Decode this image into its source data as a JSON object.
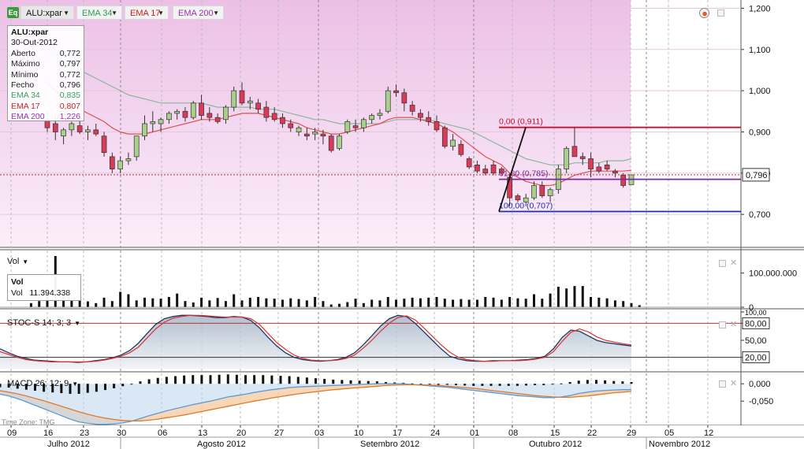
{
  "toolbar": {
    "logo_text": "Eq",
    "symbol_chip": "ALU:xpar",
    "ema34_chip": "EMA 34",
    "ema17_chip": "EMA 17",
    "ema200_chip": "EMA 200"
  },
  "info_box": {
    "title": "ALU:xpar",
    "date": "30-Out-2012",
    "rows": [
      {
        "label": "Aberto",
        "value": "0,772",
        "color": "#222222"
      },
      {
        "label": "Máximo",
        "value": "0,797",
        "color": "#222222"
      },
      {
        "label": "Mínimo",
        "value": "0,772",
        "color": "#222222"
      },
      {
        "label": "Fecho",
        "value": "0,796",
        "color": "#222222"
      },
      {
        "label": "EMA 34",
        "value": "0,835",
        "color": "#3aa05a"
      },
      {
        "label": "EMA 17",
        "value": "0,807",
        "color": "#cc2020"
      },
      {
        "label": "EMA 200",
        "value": "1,226",
        "color": "#a030b0"
      }
    ]
  },
  "vol_box": {
    "title": "Vol",
    "label": "Vol",
    "value": "11.394.338"
  },
  "panels": {
    "vol_label": "Vol",
    "stoch_label": "STOC-S 14; 3; 3",
    "macd_label": "MACD 26; 12; 9",
    "timezone": "Time Zone: TMG"
  },
  "chart_data": [
    {
      "type": "candlestick",
      "title": "ALU:xpar",
      "overlays": [
        "EMA 34",
        "EMA 17",
        "EMA 200"
      ],
      "ylim": [
        0.62,
        1.22
      ],
      "y_ticks": [
        "1,200",
        "1,100",
        "1,000",
        "0,900",
        "0,800",
        "0,700"
      ],
      "last_price_label": "0,796",
      "x_day_ticks": [
        "09",
        "16",
        "23",
        "30",
        "06",
        "13",
        "20",
        "27",
        "03",
        "10",
        "17",
        "24",
        "01",
        "08",
        "15",
        "22",
        "29",
        "05",
        "12"
      ],
      "x_month_labels": [
        "Julho 2012",
        "Agosto 2012",
        "Setembro 2012",
        "Outubro 2012",
        "Novembro 2012"
      ],
      "candles": [
        {
          "o": 0.93,
          "h": 0.95,
          "l": 0.9,
          "c": 0.91
        },
        {
          "o": 0.92,
          "h": 0.94,
          "l": 0.88,
          "c": 0.9
        },
        {
          "o": 0.89,
          "h": 0.91,
          "l": 0.87,
          "c": 0.905
        },
        {
          "o": 0.905,
          "h": 0.925,
          "l": 0.89,
          "c": 0.92
        },
        {
          "o": 0.915,
          "h": 0.93,
          "l": 0.895,
          "c": 0.9
        },
        {
          "o": 0.9,
          "h": 0.915,
          "l": 0.88,
          "c": 0.905
        },
        {
          "o": 0.905,
          "h": 0.92,
          "l": 0.89,
          "c": 0.895
        },
        {
          "o": 0.89,
          "h": 0.9,
          "l": 0.84,
          "c": 0.85
        },
        {
          "o": 0.84,
          "h": 0.85,
          "l": 0.8,
          "c": 0.81
        },
        {
          "o": 0.81,
          "h": 0.84,
          "l": 0.8,
          "c": 0.83
        },
        {
          "o": 0.83,
          "h": 0.85,
          "l": 0.82,
          "c": 0.835
        },
        {
          "o": 0.84,
          "h": 0.89,
          "l": 0.83,
          "c": 0.89
        },
        {
          "o": 0.89,
          "h": 0.94,
          "l": 0.88,
          "c": 0.92
        },
        {
          "o": 0.92,
          "h": 0.95,
          "l": 0.9,
          "c": 0.925
        },
        {
          "o": 0.92,
          "h": 0.935,
          "l": 0.9,
          "c": 0.93
        },
        {
          "o": 0.93,
          "h": 0.95,
          "l": 0.92,
          "c": 0.945
        },
        {
          "o": 0.945,
          "h": 0.955,
          "l": 0.93,
          "c": 0.95
        },
        {
          "o": 0.95,
          "h": 0.96,
          "l": 0.925,
          "c": 0.935
        },
        {
          "o": 0.935,
          "h": 0.975,
          "l": 0.93,
          "c": 0.97
        },
        {
          "o": 0.97,
          "h": 0.99,
          "l": 0.93,
          "c": 0.94
        },
        {
          "o": 0.945,
          "h": 0.96,
          "l": 0.925,
          "c": 0.935
        },
        {
          "o": 0.935,
          "h": 0.945,
          "l": 0.92,
          "c": 0.925
        },
        {
          "o": 0.93,
          "h": 0.965,
          "l": 0.92,
          "c": 0.96
        },
        {
          "o": 0.96,
          "h": 1.01,
          "l": 0.95,
          "c": 1.0
        },
        {
          "o": 1.0,
          "h": 1.02,
          "l": 0.965,
          "c": 0.97
        },
        {
          "o": 0.97,
          "h": 0.985,
          "l": 0.955,
          "c": 0.975
        },
        {
          "o": 0.97,
          "h": 0.98,
          "l": 0.945,
          "c": 0.955
        },
        {
          "o": 0.96,
          "h": 0.975,
          "l": 0.925,
          "c": 0.935
        },
        {
          "o": 0.945,
          "h": 0.96,
          "l": 0.925,
          "c": 0.93
        },
        {
          "o": 0.935,
          "h": 0.945,
          "l": 0.91,
          "c": 0.92
        },
        {
          "o": 0.92,
          "h": 0.93,
          "l": 0.9,
          "c": 0.91
        },
        {
          "o": 0.9,
          "h": 0.915,
          "l": 0.89,
          "c": 0.91
        },
        {
          "o": 0.895,
          "h": 0.91,
          "l": 0.88,
          "c": 0.89
        },
        {
          "o": 0.895,
          "h": 0.91,
          "l": 0.88,
          "c": 0.9
        },
        {
          "o": 0.895,
          "h": 0.905,
          "l": 0.87,
          "c": 0.89
        },
        {
          "o": 0.89,
          "h": 0.895,
          "l": 0.85,
          "c": 0.855
        },
        {
          "o": 0.86,
          "h": 0.895,
          "l": 0.855,
          "c": 0.89
        },
        {
          "o": 0.9,
          "h": 0.93,
          "l": 0.895,
          "c": 0.925
        },
        {
          "o": 0.915,
          "h": 0.93,
          "l": 0.9,
          "c": 0.91
        },
        {
          "o": 0.91,
          "h": 0.935,
          "l": 0.9,
          "c": 0.93
        },
        {
          "o": 0.93,
          "h": 0.945,
          "l": 0.92,
          "c": 0.94
        },
        {
          "o": 0.94,
          "h": 0.955,
          "l": 0.93,
          "c": 0.945
        },
        {
          "o": 0.95,
          "h": 1.01,
          "l": 0.945,
          "c": 1.0
        },
        {
          "o": 1.0,
          "h": 1.015,
          "l": 0.985,
          "c": 0.995
        },
        {
          "o": 0.995,
          "h": 1.005,
          "l": 0.95,
          "c": 0.97
        },
        {
          "o": 0.965,
          "h": 0.975,
          "l": 0.94,
          "c": 0.95
        },
        {
          "o": 0.945,
          "h": 0.955,
          "l": 0.925,
          "c": 0.935
        },
        {
          "o": 0.935,
          "h": 0.95,
          "l": 0.915,
          "c": 0.925
        },
        {
          "o": 0.925,
          "h": 0.94,
          "l": 0.9,
          "c": 0.905
        },
        {
          "o": 0.91,
          "h": 0.915,
          "l": 0.86,
          "c": 0.865
        },
        {
          "o": 0.865,
          "h": 0.895,
          "l": 0.855,
          "c": 0.88
        },
        {
          "o": 0.87,
          "h": 0.88,
          "l": 0.84,
          "c": 0.845
        },
        {
          "o": 0.835,
          "h": 0.84,
          "l": 0.81,
          "c": 0.815
        },
        {
          "o": 0.82,
          "h": 0.83,
          "l": 0.8,
          "c": 0.805
        },
        {
          "o": 0.81,
          "h": 0.82,
          "l": 0.795,
          "c": 0.8
        },
        {
          "o": 0.82,
          "h": 0.83,
          "l": 0.795,
          "c": 0.8
        },
        {
          "o": 0.81,
          "h": 0.815,
          "l": 0.795,
          "c": 0.8
        },
        {
          "o": 0.79,
          "h": 0.8,
          "l": 0.72,
          "c": 0.74
        },
        {
          "o": 0.745,
          "h": 0.75,
          "l": 0.73,
          "c": 0.735
        },
        {
          "o": 0.73,
          "h": 0.75,
          "l": 0.72,
          "c": 0.74
        },
        {
          "o": 0.74,
          "h": 0.78,
          "l": 0.735,
          "c": 0.77
        },
        {
          "o": 0.77,
          "h": 0.78,
          "l": 0.74,
          "c": 0.745
        },
        {
          "o": 0.745,
          "h": 0.765,
          "l": 0.73,
          "c": 0.76
        },
        {
          "o": 0.76,
          "h": 0.82,
          "l": 0.75,
          "c": 0.81
        },
        {
          "o": 0.81,
          "h": 0.865,
          "l": 0.8,
          "c": 0.86
        },
        {
          "o": 0.865,
          "h": 0.91,
          "l": 0.84,
          "c": 0.84
        },
        {
          "o": 0.84,
          "h": 0.85,
          "l": 0.82,
          "c": 0.835
        },
        {
          "o": 0.835,
          "h": 0.85,
          "l": 0.79,
          "c": 0.81
        },
        {
          "o": 0.815,
          "h": 0.825,
          "l": 0.8,
          "c": 0.805
        },
        {
          "o": 0.82,
          "h": 0.83,
          "l": 0.805,
          "c": 0.81
        },
        {
          "o": 0.805,
          "h": 0.81,
          "l": 0.79,
          "c": 0.8
        },
        {
          "o": 0.795,
          "h": 0.8,
          "l": 0.765,
          "c": 0.77
        },
        {
          "o": 0.772,
          "h": 0.797,
          "l": 0.772,
          "c": 0.796
        }
      ],
      "ema34": [
        1.1,
        1.09,
        1.07,
        1.06,
        1.05,
        1.04,
        1.03,
        1.02,
        1.01,
        1.0,
        0.99,
        0.985,
        0.98,
        0.975,
        0.97,
        0.97,
        0.97,
        0.97,
        0.97,
        0.97,
        0.965,
        0.96,
        0.96,
        0.96,
        0.96,
        0.96,
        0.955,
        0.955,
        0.955,
        0.95,
        0.945,
        0.94,
        0.935,
        0.93,
        0.93,
        0.925,
        0.92,
        0.92,
        0.92,
        0.92,
        0.92,
        0.92,
        0.925,
        0.93,
        0.93,
        0.93,
        0.93,
        0.93,
        0.925,
        0.92,
        0.915,
        0.91,
        0.905,
        0.895,
        0.885,
        0.875,
        0.865,
        0.855,
        0.845,
        0.835,
        0.83,
        0.825,
        0.82,
        0.82,
        0.82,
        0.825,
        0.825,
        0.825,
        0.825,
        0.83,
        0.83,
        0.83,
        0.835
      ],
      "ema17": [
        1.02,
        1.0,
        0.98,
        0.965,
        0.955,
        0.945,
        0.935,
        0.925,
        0.91,
        0.9,
        0.895,
        0.895,
        0.895,
        0.9,
        0.905,
        0.91,
        0.915,
        0.92,
        0.925,
        0.93,
        0.93,
        0.93,
        0.935,
        0.94,
        0.945,
        0.945,
        0.945,
        0.94,
        0.935,
        0.93,
        0.925,
        0.92,
        0.91,
        0.905,
        0.9,
        0.895,
        0.895,
        0.9,
        0.905,
        0.91,
        0.915,
        0.92,
        0.93,
        0.935,
        0.935,
        0.935,
        0.93,
        0.925,
        0.92,
        0.91,
        0.9,
        0.885,
        0.87,
        0.855,
        0.84,
        0.83,
        0.82,
        0.8,
        0.79,
        0.78,
        0.775,
        0.77,
        0.77,
        0.775,
        0.785,
        0.795,
        0.8,
        0.805,
        0.805,
        0.805,
        0.805,
        0.805,
        0.807
      ],
      "fibonacci": [
        {
          "label": "0,00 (0,911)",
          "value": 0.911
        },
        {
          "label": "61,80 (0,785)",
          "value": 0.785
        },
        {
          "label": "100,00 (0,707)",
          "value": 0.707
        }
      ]
    },
    {
      "type": "bar",
      "title": "Vol",
      "y_ticks": [
        "100.000.000",
        "0"
      ],
      "ylim": [
        0,
        150000000
      ],
      "values": [
        12000000,
        18000000,
        55000000,
        150000000,
        35000000,
        22000000,
        20000000,
        17000000,
        12000000,
        28000000,
        18000000,
        45000000,
        38000000,
        20000000,
        28000000,
        26000000,
        25000000,
        30000000,
        40000000,
        18000000,
        14000000,
        28000000,
        20000000,
        27000000,
        18000000,
        38000000,
        20000000,
        28000000,
        30000000,
        26000000,
        25000000,
        22000000,
        26000000,
        24000000,
        20000000,
        30000000,
        18000000,
        8000000,
        10000000,
        15000000,
        25000000,
        12000000,
        22000000,
        20000000,
        30000000,
        22000000,
        25000000,
        28000000,
        26000000,
        28000000,
        30000000,
        25000000,
        22000000,
        24000000,
        22000000,
        22000000,
        30000000,
        28000000,
        22000000,
        30000000,
        26000000,
        25000000,
        38000000,
        25000000,
        40000000,
        60000000,
        55000000,
        62000000,
        62000000,
        30000000,
        28000000,
        26000000,
        20000000,
        18000000,
        12000000,
        6000000
      ]
    },
    {
      "type": "line",
      "title": "STOC-S 14; 3; 3",
      "ylim": [
        0,
        100
      ],
      "y_ticks": [
        "100,00",
        "80,00",
        "50,00",
        "20,00"
      ],
      "levels": [
        80,
        20
      ],
      "k": [
        35,
        28,
        22,
        18,
        15,
        14,
        13,
        12,
        12,
        11,
        12,
        14,
        16,
        19,
        24,
        32,
        45,
        62,
        78,
        88,
        92,
        94,
        94,
        93,
        92,
        90,
        90,
        92,
        91,
        85,
        72,
        55,
        40,
        28,
        20,
        16,
        14,
        13,
        14,
        16,
        20,
        28,
        42,
        58,
        75,
        88,
        94,
        92,
        80,
        65,
        50,
        35,
        22,
        17,
        14,
        13,
        13,
        14,
        14,
        14,
        15,
        16,
        18,
        22,
        35,
        55,
        68,
        66,
        58,
        50,
        46,
        44,
        42,
        40
      ],
      "d": [
        30,
        25,
        20,
        16,
        14,
        13,
        12,
        12,
        12,
        12,
        12,
        13,
        15,
        18,
        22,
        28,
        38,
        54,
        70,
        82,
        89,
        92,
        94,
        94,
        93,
        92,
        91,
        91,
        91,
        88,
        78,
        62,
        46,
        34,
        24,
        18,
        15,
        14,
        14,
        15,
        18,
        24,
        36,
        50,
        66,
        80,
        90,
        93,
        86,
        72,
        57,
        42,
        29,
        20,
        16,
        14,
        13,
        13,
        14,
        14,
        14,
        15,
        17,
        20,
        30,
        48,
        64,
        70,
        65,
        56,
        50,
        47,
        44,
        42
      ]
    },
    {
      "type": "area",
      "title": "MACD 26; 12; 9",
      "ylim": [
        -0.12,
        0.03
      ],
      "y_ticks": [
        "0,000",
        "-0,050"
      ],
      "macd": [
        -0.03,
        -0.035,
        -0.043,
        -0.052,
        -0.062,
        -0.072,
        -0.082,
        -0.092,
        -0.102,
        -0.11,
        -0.114,
        -0.117,
        -0.117,
        -0.116,
        -0.113,
        -0.108,
        -0.1,
        -0.092,
        -0.085,
        -0.078,
        -0.072,
        -0.066,
        -0.06,
        -0.055,
        -0.05,
        -0.044,
        -0.038,
        -0.034,
        -0.03,
        -0.025,
        -0.021,
        -0.017,
        -0.014,
        -0.011,
        -0.009,
        -0.008,
        -0.007,
        -0.006,
        -0.005,
        -0.004,
        -0.003,
        -0.002,
        -0.001,
        0.0,
        0.0,
        0.0,
        0.0,
        -0.002,
        -0.004,
        -0.006,
        -0.008,
        -0.01,
        -0.013,
        -0.016,
        -0.019,
        -0.022,
        -0.025,
        -0.028,
        -0.031,
        -0.034,
        -0.036,
        -0.038,
        -0.04,
        -0.04,
        -0.038,
        -0.034,
        -0.028,
        -0.024,
        -0.021,
        -0.019,
        -0.018,
        -0.017,
        -0.017
      ],
      "signal": [
        -0.02,
        -0.024,
        -0.029,
        -0.035,
        -0.042,
        -0.049,
        -0.057,
        -0.065,
        -0.073,
        -0.081,
        -0.088,
        -0.094,
        -0.099,
        -0.103,
        -0.106,
        -0.107,
        -0.107,
        -0.105,
        -0.102,
        -0.098,
        -0.094,
        -0.09,
        -0.085,
        -0.08,
        -0.075,
        -0.07,
        -0.065,
        -0.06,
        -0.055,
        -0.05,
        -0.046,
        -0.041,
        -0.037,
        -0.033,
        -0.029,
        -0.026,
        -0.023,
        -0.02,
        -0.017,
        -0.015,
        -0.013,
        -0.011,
        -0.009,
        -0.007,
        -0.005,
        -0.004,
        -0.003,
        -0.003,
        -0.003,
        -0.004,
        -0.005,
        -0.007,
        -0.009,
        -0.011,
        -0.013,
        -0.016,
        -0.019,
        -0.022,
        -0.025,
        -0.028,
        -0.031,
        -0.034,
        -0.036,
        -0.038,
        -0.039,
        -0.039,
        -0.037,
        -0.035,
        -0.032,
        -0.029,
        -0.026,
        -0.024,
        -0.022
      ],
      "histogram": [
        -0.01,
        -0.011,
        -0.014,
        -0.017,
        -0.02,
        -0.023,
        -0.025,
        -0.027,
        -0.029,
        -0.029,
        -0.026,
        -0.023,
        -0.018,
        -0.013,
        -0.007,
        -0.001,
        0.007,
        0.013,
        0.017,
        0.02,
        0.022,
        0.024,
        0.025,
        0.025,
        0.025,
        0.026,
        0.027,
        0.026,
        0.025,
        0.025,
        0.025,
        0.024,
        0.023,
        0.022,
        0.02,
        0.018,
        0.016,
        0.014,
        0.012,
        0.011,
        0.01,
        0.009,
        0.008,
        0.007,
        0.005,
        0.004,
        0.003,
        0.001,
        -0.001,
        -0.002,
        -0.003,
        -0.003,
        -0.004,
        -0.005,
        -0.006,
        -0.006,
        -0.006,
        -0.006,
        -0.006,
        -0.006,
        -0.005,
        -0.004,
        -0.004,
        -0.002,
        0.001,
        0.005,
        0.009,
        0.011,
        0.011,
        0.01,
        0.008,
        0.007,
        0.005
      ]
    }
  ]
}
